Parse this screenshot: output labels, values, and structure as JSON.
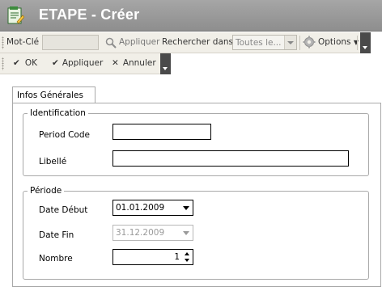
{
  "window": {
    "title": "ETAPE - Créer",
    "icon": "form-document-icon"
  },
  "toolbar_search": {
    "keyword_label": "Mot-Clé",
    "keyword_value": "",
    "apply_label": "Appliquer",
    "search_in_label": "Rechercher dans",
    "search_in_value": "Toutes le...",
    "options_label": "Options"
  },
  "toolbar_actions": {
    "ok_label": "OK",
    "apply_label": "Appliquer",
    "cancel_label": "Annuler"
  },
  "form": {
    "tab_label": "Infos Générales",
    "identification": {
      "legend": "Identification",
      "period_code_label": "Period Code",
      "period_code_value": "",
      "libelle_label": "Libellé",
      "libelle_value": ""
    },
    "periode": {
      "legend": "Période",
      "date_debut_label": "Date Début",
      "date_debut_value": "01.01.2009",
      "date_fin_label": "Date Fin",
      "date_fin_value": "31.12.2009",
      "nombre_label": "Nombre",
      "nombre_value": "1"
    }
  },
  "colors": {
    "titlebar": "#9b9b9b",
    "toolbar": "#f1efe8",
    "border": "#a9a9a9"
  }
}
